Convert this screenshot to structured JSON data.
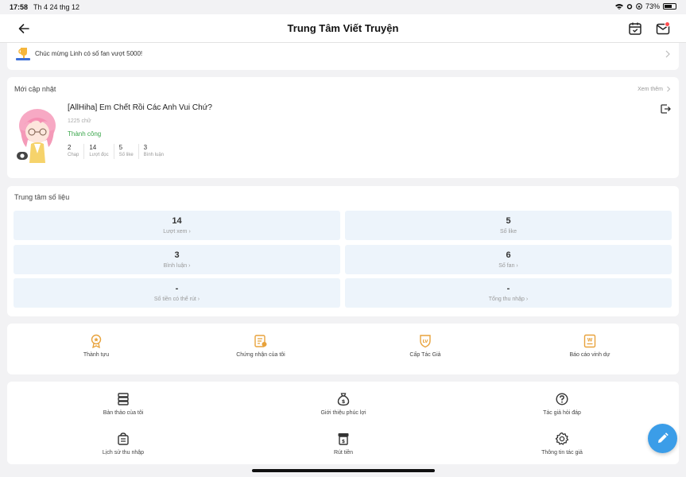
{
  "status_bar": {
    "time": "17:58",
    "date": "Th 4 24 thg 12",
    "battery": "73%",
    "battery_level": 0.73
  },
  "header": {
    "title": "Trung Tâm Viết Truyện"
  },
  "notice": {
    "text": "Chúc mừng Linh có số fan vượt 5000!"
  },
  "recent": {
    "section_title": "Mới cập nhật",
    "more_label": "Xem thêm",
    "work": {
      "title": "[AllHiha] Em Chết Rồi Các Anh Vui Chứ?",
      "word_count": "1225 chữ",
      "status": "Thành công",
      "stats": [
        {
          "value": "2",
          "label": "Chap"
        },
        {
          "value": "14",
          "label": "Lượt đọc"
        },
        {
          "value": "5",
          "label": "Số like"
        },
        {
          "value": "3",
          "label": "Bình luận"
        }
      ]
    }
  },
  "data_center": {
    "section_title": "Trung tâm số liệu",
    "tiles": [
      {
        "value": "14",
        "label": "Lượt xem"
      },
      {
        "value": "5",
        "label": "Số like"
      },
      {
        "value": "3",
        "label": "Bình luận"
      },
      {
        "value": "6",
        "label": "Số fan"
      },
      {
        "value": "-",
        "label": "Số tiền có thể rút"
      },
      {
        "value": "-",
        "label": "Tổng thu nhập"
      }
    ]
  },
  "achievements": {
    "items": [
      {
        "label": "Thành tựu",
        "icon": "medal-icon"
      },
      {
        "label": "Chứng nhận của tôi",
        "icon": "certificate-icon"
      },
      {
        "label": "Cấp Tác Giả",
        "icon": "level-badge-icon"
      },
      {
        "label": "Báo cáo vinh dự",
        "icon": "honor-report-icon"
      }
    ]
  },
  "tools": {
    "items": [
      {
        "label": "Bản thảo của tôi",
        "icon": "drafts-icon"
      },
      {
        "label": "Giới thiệu phúc lợi",
        "icon": "money-bag-icon"
      },
      {
        "label": "Tác giả hỏi đáp",
        "icon": "question-icon"
      },
      {
        "label": "Lịch sử thu nhập",
        "icon": "income-history-icon"
      },
      {
        "label": "Rút tiền",
        "icon": "withdraw-icon"
      },
      {
        "label": "Thông tin tác giả",
        "icon": "settings-gear-icon"
      }
    ]
  },
  "colors": {
    "accent": "#3b9de8",
    "success": "#3aa64b",
    "gold": "#e8a23b",
    "tile_bg": "#edf4fb",
    "badge": "#ff4d4f"
  }
}
